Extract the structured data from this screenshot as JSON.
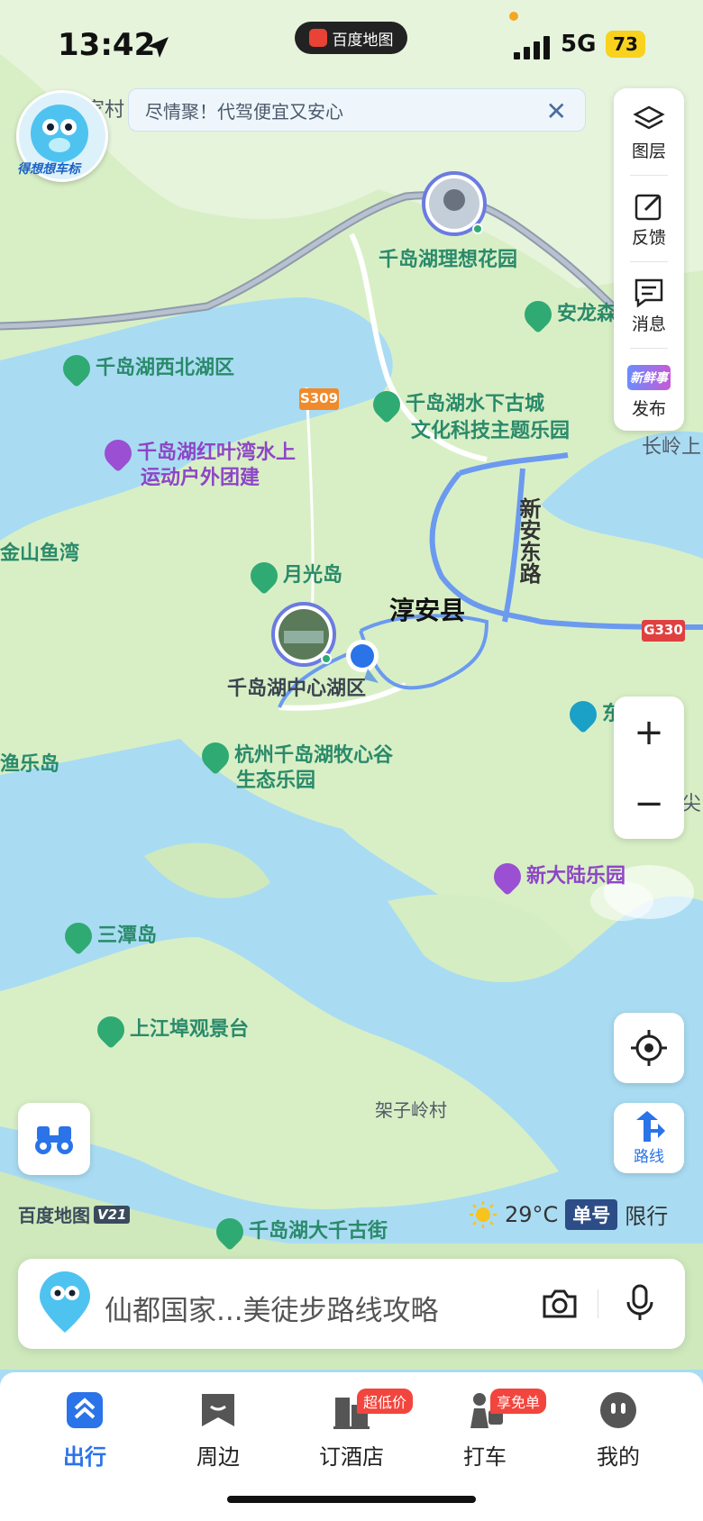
{
  "status_bar": {
    "time": "13:42",
    "network": "5G",
    "battery": "73"
  },
  "app_pill": {
    "label": "百度地图"
  },
  "banner": {
    "text": "尽情聚！代驾便宜又安心",
    "close_icon": "close-icon"
  },
  "logo_badge": {
    "label": "得想想车标"
  },
  "right_panel": {
    "layers_label": "图层",
    "feedback_label": "反馈",
    "messages_label": "消息",
    "publish_label": "发布",
    "publish_badge": "新鲜事"
  },
  "map": {
    "county": "淳安县",
    "road_labels": [
      "S309",
      "G330",
      "新安东路"
    ],
    "pois": {
      "flower_garden": "千岛湖理想花园",
      "northwest_lake": "千岛湖西北湖区",
      "underwater_city_1": "千岛湖水下古城",
      "underwater_city_2": "文化科技主题乐园",
      "redleaf_bay_1": "千岛湖红叶湾水上",
      "redleaf_bay_2": "运动户外团建",
      "jinshan_bay": "金山鱼湾",
      "moonlight_island": "月光岛",
      "center_lake": "千岛湖中心湖区",
      "fishing_island": "渔乐岛",
      "muxingu_1": "杭州千岛湖牧心谷",
      "muxingu_2": "生态乐园",
      "new_continent": "新大陆乐园",
      "santan_island": "三潭岛",
      "shangjiangbu": "上江埠观景台",
      "jiaziling": "架子岭村",
      "daqian_street": "千岛湖大千古街",
      "anlong": "安龙森",
      "changling": "长岭上",
      "village_top": "家村",
      "east_south": "东南",
      "jian": "尖"
    }
  },
  "controls": {
    "zoom_in": "+",
    "zoom_out": "−",
    "route_label": "路线"
  },
  "brand": {
    "name": "百度地图",
    "version": "V21"
  },
  "weather": {
    "temperature": "29°C",
    "plate": "单号",
    "restriction": "限行"
  },
  "search": {
    "placeholder": "仙都国家...美徒步路线攻略"
  },
  "tabs": [
    {
      "label": "出行",
      "active": true
    },
    {
      "label": "周边"
    },
    {
      "label": "订酒店",
      "badge": "超低价"
    },
    {
      "label": "打车",
      "badge": "享免单"
    },
    {
      "label": "我的"
    }
  ],
  "colors": {
    "water": "#a9dcf3",
    "land": "#d8efc6",
    "accent": "#2a73e8",
    "poi_green": "#2a8a6a",
    "poi_purple": "#8e45c6"
  }
}
